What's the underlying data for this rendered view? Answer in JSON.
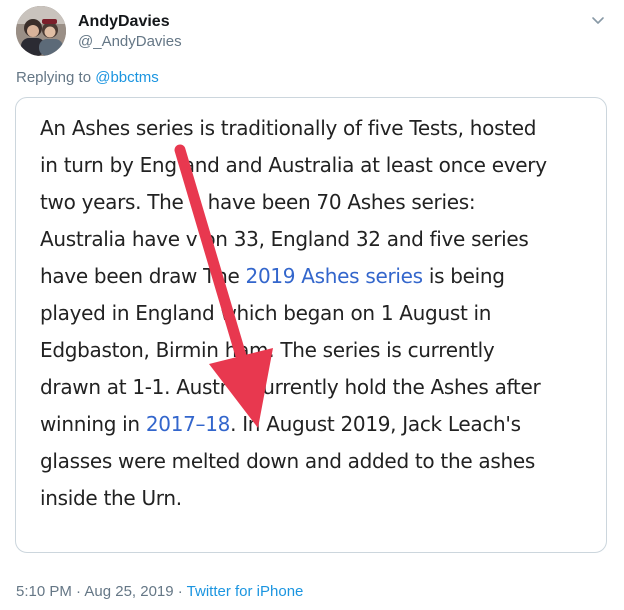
{
  "author": {
    "display_name": "AndyDavies",
    "username": "@_AndyDavies"
  },
  "reply": {
    "prefix": "Replying to ",
    "handle": "@bbctms"
  },
  "card": {
    "lines": [
      "An Ashes series is traditionally of five Tests, hosted",
      "in turn by Eng  and and Australia at least once every",
      "two years. The  e have been 70 Ashes series:",
      "Australia have  v on 33, England 32 and five series",
      "have been draw   The "
    ],
    "link_1": "2019 Ashes series",
    "line_5_after": " is being",
    "lines_b": [
      "played in England  which began on 1 August in",
      "Edgbaston, Birmin   ham. The series is currently",
      "drawn at 1-1. Austr   a currently hold the Ashes after"
    ],
    "line_9_before": "winning in ",
    "link_2": "2017–18",
    "line_9_after": ". In August 2019, Jack Leach's",
    "lines_c": [
      "glasses were melted down and added to the ashes",
      "inside the Urn."
    ]
  },
  "meta": {
    "time_date": "5:10 PM · Aug 25, 2019 · ",
    "source": "Twitter for iPhone"
  },
  "colors": {
    "link": "#1b95e0",
    "wiki_link": "#3366cc",
    "arrow": "#e8384f",
    "muted": "#657786"
  },
  "icons": {
    "chevron": "chevron-down-icon",
    "arrow": "red-arrow-annotation"
  }
}
